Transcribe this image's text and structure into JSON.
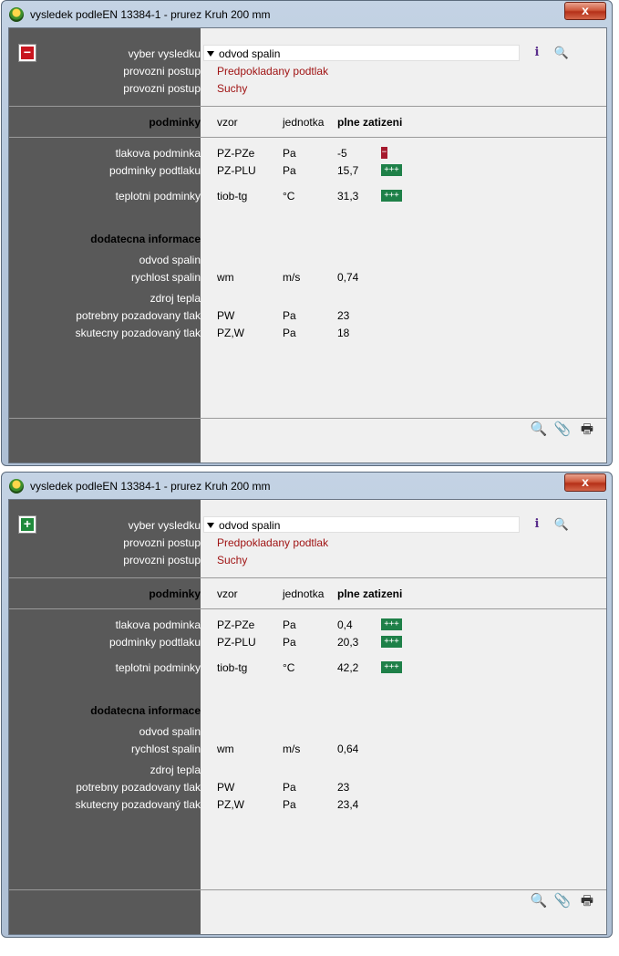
{
  "windows": [
    {
      "title": "vysledek podleEN 13384-1 - prurez Kruh 200 mm",
      "close_label": "x",
      "toggle": "minus",
      "toggle_glyph": "−",
      "labels": {
        "vyber": "vyber vysledku",
        "postup1": "provozni postup",
        "postup2": "provozni postup",
        "podminky": "podminky",
        "tlakova": "tlakova podminka",
        "podtlak": "podminky podtlaku",
        "teplotni": "teplotni podminky",
        "dodatecna": "dodatecna informace",
        "odvod": "odvod spalin",
        "rychlost": "rychlost spalin",
        "zdroj": "zdroj tepla",
        "potrebny": "potrebny pozadovany tlak",
        "skutecny": "skutecny pozadovaný tlak"
      },
      "selection": "odvod spalin",
      "postup1_value": "Predpokladany podtlak",
      "postup2_value": "Suchy",
      "headers": {
        "vzor": "vzor",
        "jednotka": "jednotka",
        "plne": "plne zatizeni"
      },
      "rows": {
        "tlakova": {
          "vzor": "PZ-PZe",
          "jednotka": "Pa",
          "value": "-5",
          "status": "−",
          "status_ok": false
        },
        "podtlak": {
          "vzor": "PZ-PLU",
          "jednotka": "Pa",
          "value": "15,7",
          "status": "+++",
          "status_ok": true
        },
        "teplotni": {
          "vzor": "tiob-tg",
          "jednotka": "°C",
          "value": "31,3",
          "status": "+++",
          "status_ok": true
        },
        "rychlost": {
          "vzor": "wm",
          "jednotka": "m/s",
          "value": "0,74"
        },
        "potrebny": {
          "vzor": "PW",
          "jednotka": "Pa",
          "value": "23"
        },
        "skutecny": {
          "vzor": "PZ,W",
          "jednotka": "Pa",
          "value": "18"
        }
      },
      "icons": {
        "info": "i",
        "search": "🔍",
        "preview": "🔍",
        "clip": "📎",
        "print": "🖶"
      }
    },
    {
      "title": "vysledek podleEN 13384-1 - prurez Kruh 200 mm",
      "close_label": "x",
      "toggle": "plus",
      "toggle_glyph": "+",
      "labels": {
        "vyber": "vyber vysledku",
        "postup1": "provozni postup",
        "postup2": "provozni postup",
        "podminky": "podminky",
        "tlakova": "tlakova podminka",
        "podtlak": "podminky podtlaku",
        "teplotni": "teplotni podminky",
        "dodatecna": "dodatecna informace",
        "odvod": "odvod spalin",
        "rychlost": "rychlost spalin",
        "zdroj": "zdroj tepla",
        "potrebny": "potrebny pozadovany tlak",
        "skutecny": "skutecny pozadovaný tlak"
      },
      "selection": "odvod spalin",
      "postup1_value": "Predpokladany podtlak",
      "postup2_value": "Suchy",
      "headers": {
        "vzor": "vzor",
        "jednotka": "jednotka",
        "plne": "plne zatizeni"
      },
      "rows": {
        "tlakova": {
          "vzor": "PZ-PZe",
          "jednotka": "Pa",
          "value": "0,4",
          "status": "+++",
          "status_ok": true
        },
        "podtlak": {
          "vzor": "PZ-PLU",
          "jednotka": "Pa",
          "value": "20,3",
          "status": "+++",
          "status_ok": true
        },
        "teplotni": {
          "vzor": "tiob-tg",
          "jednotka": "°C",
          "value": "42,2",
          "status": "+++",
          "status_ok": true
        },
        "rychlost": {
          "vzor": "wm",
          "jednotka": "m/s",
          "value": "0,64"
        },
        "potrebny": {
          "vzor": "PW",
          "jednotka": "Pa",
          "value": "23"
        },
        "skutecny": {
          "vzor": "PZ,W",
          "jednotka": "Pa",
          "value": "23,4"
        }
      },
      "icons": {
        "info": "i",
        "search": "🔍",
        "preview": "🔍",
        "clip": "📎",
        "print": "🖶"
      }
    }
  ]
}
